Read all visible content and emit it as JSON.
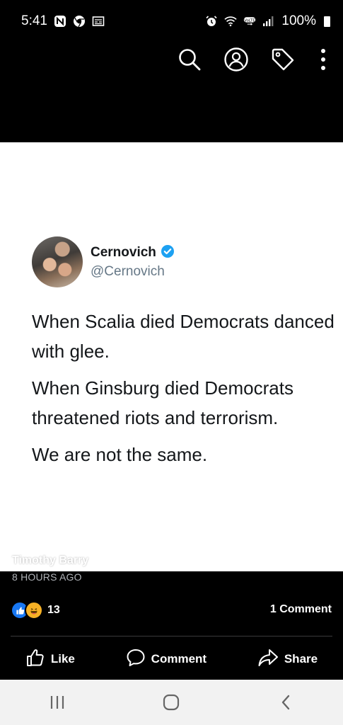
{
  "status_bar": {
    "time": "5:41",
    "left_icons": [
      "n-app-icon",
      "chrome-icon",
      "news-icon"
    ],
    "right_icons": [
      "alarm-icon",
      "wifi-icon",
      "volte-icon",
      "signal-icon"
    ],
    "battery": "100%"
  },
  "top_actions": [
    "search-icon",
    "profile-icon",
    "tag-icon",
    "more-options-icon"
  ],
  "tweet": {
    "name": "Cernovich",
    "handle": "@Cernovich",
    "verified": true,
    "lines": [
      "When Scalia died Democrats danced with glee.",
      "When Ginsburg died Democrats threatened riots and terrorism.",
      "We are not the same."
    ]
  },
  "post": {
    "author": "Timothy Barry",
    "time": "8 HOURS AGO",
    "reaction_count": "13",
    "reactions": [
      "like",
      "haha"
    ],
    "comment_count": "1 Comment"
  },
  "actions": {
    "like_label": "Like",
    "comment_label": "Comment",
    "share_label": "Share"
  },
  "nav": [
    "recent-apps-icon",
    "home-icon",
    "back-icon"
  ],
  "colors": {
    "background": "#000000",
    "photo_background": "#ffffff",
    "verified_blue": "#1da1f2",
    "like_blue": "#1877f2",
    "haha_yellow": "#f7b125",
    "nav_bar": "#f2f2f2"
  }
}
